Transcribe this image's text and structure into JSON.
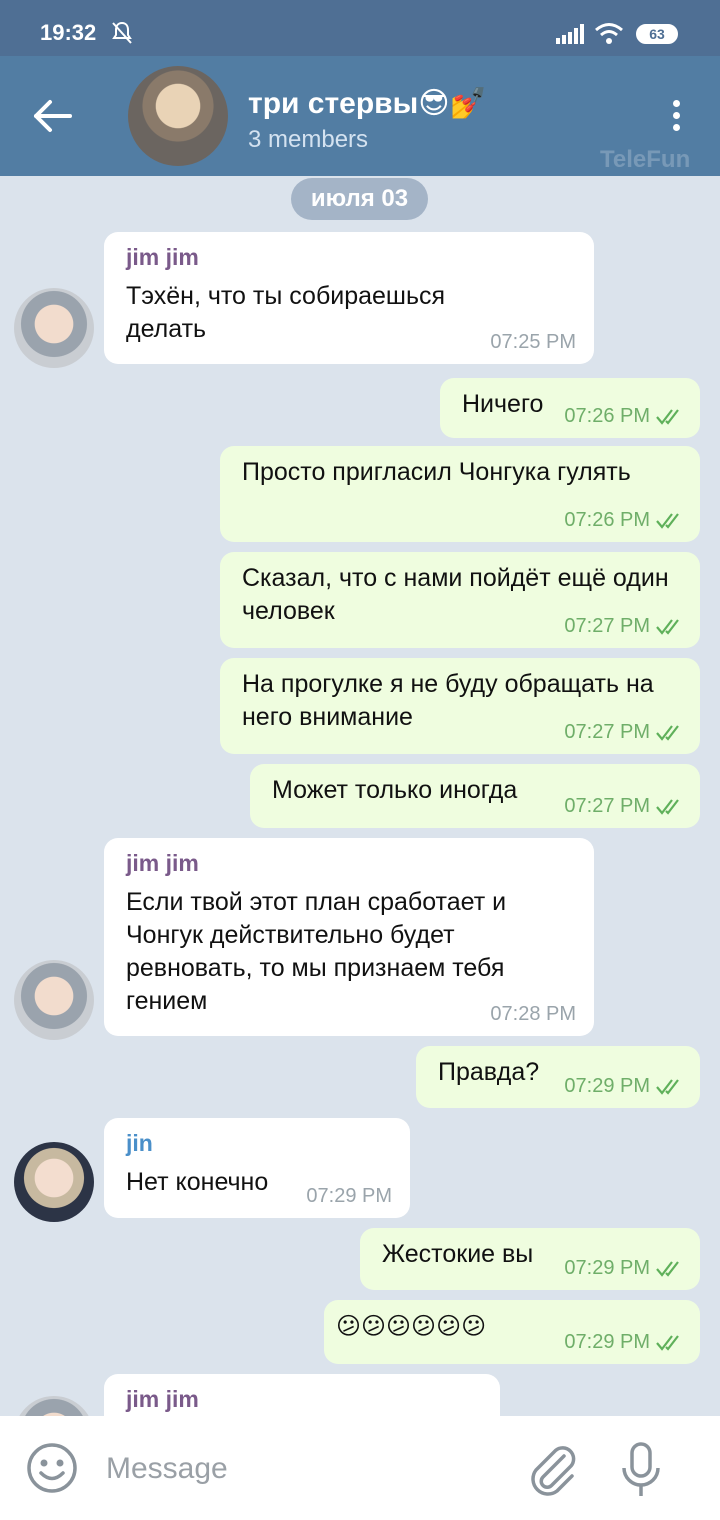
{
  "status": {
    "time": "19:32",
    "battery": "63"
  },
  "header": {
    "title": "три стервы😎💅",
    "subtitle": "3 members",
    "watermark": "TeleFun"
  },
  "chat": {
    "date": "июля 03",
    "messages": [
      {
        "dir": "in",
        "sender": "jim jim",
        "text": "Тэхён, что ты собираешься делать",
        "time": "07:25 PM"
      },
      {
        "dir": "out",
        "text": "Ничего",
        "time": "07:26 PM"
      },
      {
        "dir": "out",
        "text": "Просто пригласил Чонгука гулять",
        "time": "07:26 PM"
      },
      {
        "dir": "out",
        "text": "Сказал, что с нами пойдёт ещё один человек",
        "time": "07:27 PM"
      },
      {
        "dir": "out",
        "text": "На прогулке я не буду обращать на него внимание",
        "time": "07:27 PM"
      },
      {
        "dir": "out",
        "text": "Может только иногда",
        "time": "07:27 PM"
      },
      {
        "dir": "in",
        "sender": "jim jim",
        "text": "Если твой этот план сработает и Чонгук действительно будет ревновать, то мы признаем тебя гением",
        "time": "07:28 PM"
      },
      {
        "dir": "out",
        "text": "Правда?",
        "time": "07:29 PM"
      },
      {
        "dir": "in",
        "sender": "jin",
        "text": "Нет конечно",
        "time": "07:29 PM"
      },
      {
        "dir": "out",
        "text": "Жестокие вы",
        "time": "07:29 PM"
      },
      {
        "dir": "out",
        "text": "😕😕😕😕😕😕",
        "time": "07:29 PM"
      },
      {
        "dir": "in",
        "sender": "jim jim",
        "text": "",
        "time": ""
      }
    ]
  },
  "input": {
    "placeholder": "Message"
  },
  "colors": {
    "statusbar": "#4f6f94",
    "header": "#527da3",
    "chat_bg": "#dbe3ec",
    "incoming": "#ffffff",
    "outgoing": "#effddf",
    "sender_jimjim": "#7a5a8a",
    "sender_jin": "#4a8fc9",
    "check": "#5fb05a"
  }
}
